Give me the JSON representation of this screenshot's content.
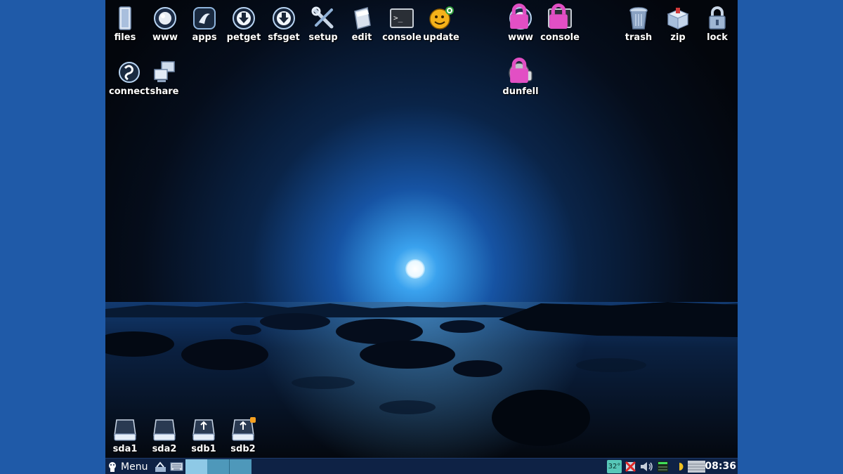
{
  "desktop": {
    "top_left_icons": [
      {
        "label": "files",
        "icon": "folder-icon"
      },
      {
        "label": "www",
        "icon": "globe-icon"
      },
      {
        "label": "apps",
        "icon": "apps-icon"
      },
      {
        "label": "petget",
        "icon": "download-arrow-icon"
      },
      {
        "label": "sfsget",
        "icon": "download-arrow-icon"
      },
      {
        "label": "setup",
        "icon": "tools-icon"
      },
      {
        "label": "edit",
        "icon": "notepad-icon"
      },
      {
        "label": "console",
        "icon": "terminal-icon"
      },
      {
        "label": "update",
        "icon": "update-smiley-icon"
      }
    ],
    "second_row_icons": [
      {
        "label": "connect",
        "icon": "connect-icon"
      },
      {
        "label": "share",
        "icon": "share-computers-icon"
      }
    ],
    "locked_icons": [
      {
        "label": "www",
        "icon": "globe-icon"
      },
      {
        "label": "console",
        "icon": "terminal-icon"
      },
      {
        "label": "dunfell",
        "icon": "thumbs-up-face-icon"
      }
    ],
    "top_right_icons": [
      {
        "label": "trash",
        "icon": "trash-icon"
      },
      {
        "label": "zip",
        "icon": "zip-box-icon"
      },
      {
        "label": "lock",
        "icon": "padlock-icon"
      }
    ],
    "drive_icons": [
      {
        "label": "sda1",
        "icon": "hard-drive-icon"
      },
      {
        "label": "sda2",
        "icon": "hard-drive-icon"
      },
      {
        "label": "sdb1",
        "icon": "usb-drive-icon"
      },
      {
        "label": "sdb2",
        "icon": "usb-drive-icon",
        "mounted": true
      }
    ]
  },
  "taskbar": {
    "menu_label": "Menu",
    "pager_desktops": 3,
    "active_desktop": 1,
    "tray": {
      "temperature": "32°",
      "clock": "08:36"
    }
  },
  "colors": {
    "frame_background": "#1f5aa8",
    "taskbar": "#0e2245",
    "pager_active": "#8ec9e6",
    "pager_inactive": "#4e98ba",
    "mounted_badge": "#f5a020"
  }
}
